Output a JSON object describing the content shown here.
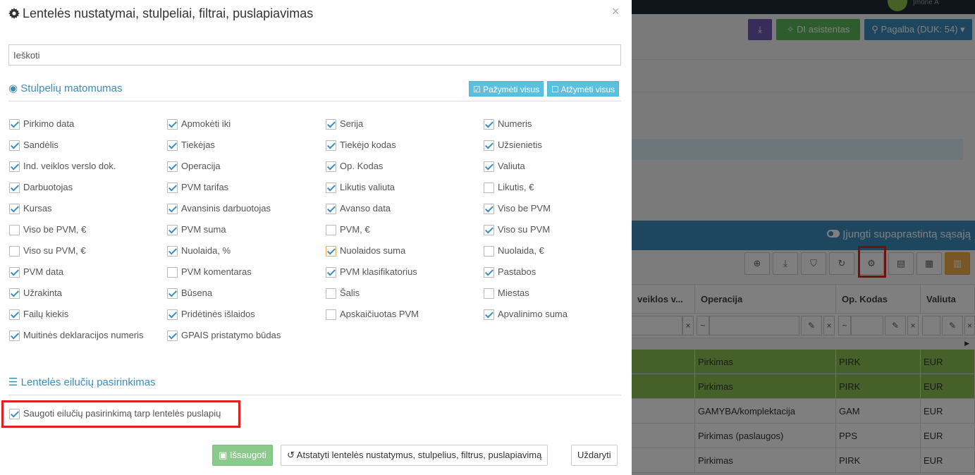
{
  "background": {
    "company": "Įmonė A",
    "header_buttons": {
      "ai": "DI asistentas",
      "help": "Pagalba (DUK: 54)"
    },
    "simplify_toggle": "Įjungti supaprastintą sąsają",
    "grid_headers": [
      " veiklos v...",
      "Operacija",
      "Op. Kodas",
      "Valiuta"
    ],
    "filter_op": "~",
    "filter_clear": "×",
    "rows": [
      {
        "operacija": "Pirkimas",
        "kodas": "PIRK",
        "valiuta": "EUR",
        "highlight": "#8cc152"
      },
      {
        "operacija": "Pirkimas",
        "kodas": "PIRK",
        "valiuta": "EUR",
        "highlight": "#8cc152"
      },
      {
        "operacija": "GAMYBA/komplektacija",
        "kodas": "GAM",
        "valiuta": "EUR",
        "highlight": ""
      },
      {
        "operacija": "Pirkimas (paslaugos)",
        "kodas": "PPS",
        "valiuta": "EUR",
        "highlight": ""
      },
      {
        "operacija": "Pirkimas",
        "kodas": "PIRK",
        "valiuta": "EUR",
        "highlight": ""
      }
    ]
  },
  "modal": {
    "title": "Lentelės nustatymai, stulpeliai, filtrai, puslapiavimas",
    "close": "×",
    "search_placeholder": "Ieškoti",
    "visibility_section": "Stulpelių matomumas",
    "select_all": "Pažymėti visus",
    "deselect_all": "Atžymėti visus",
    "columns": [
      [
        {
          "label": "Pirkimo data",
          "checked": true
        },
        {
          "label": "Sandėlis",
          "checked": true
        },
        {
          "label": "Ind. veiklos verslo dok.",
          "checked": true
        },
        {
          "label": "Darbuotojas",
          "checked": true
        },
        {
          "label": "Kursas",
          "checked": true
        },
        {
          "label": "Viso be PVM, €",
          "checked": false
        },
        {
          "label": "Viso su PVM, €",
          "checked": false
        },
        {
          "label": "PVM data",
          "checked": true
        },
        {
          "label": "Užrakinta",
          "checked": true
        },
        {
          "label": "Failų kiekis",
          "checked": true
        },
        {
          "label": "Muitinės deklaracijos numeris",
          "checked": true
        }
      ],
      [
        {
          "label": "Apmokėti iki",
          "checked": true
        },
        {
          "label": "Tiekėjas",
          "checked": true
        },
        {
          "label": "Operacija",
          "checked": true
        },
        {
          "label": "PVM tarifas",
          "checked": true
        },
        {
          "label": "Avansinis darbuotojas",
          "checked": true
        },
        {
          "label": "PVM suma",
          "checked": true
        },
        {
          "label": "Nuolaida, %",
          "checked": true
        },
        {
          "label": "PVM komentaras",
          "checked": false
        },
        {
          "label": "Būsena",
          "checked": true
        },
        {
          "label": "Pridėtinės išlaidos",
          "checked": true
        },
        {
          "label": "GPAIS pristatymo būdas",
          "checked": true
        }
      ],
      [
        {
          "label": "Serija",
          "checked": true
        },
        {
          "label": "Tiekėjo kodas",
          "checked": true
        },
        {
          "label": "Op. Kodas",
          "checked": true
        },
        {
          "label": "Likutis valiuta",
          "checked": true
        },
        {
          "label": "Avanso data",
          "checked": true
        },
        {
          "label": "PVM, €",
          "checked": false
        },
        {
          "label": "Nuolaidos suma",
          "checked": true,
          "focused": true
        },
        {
          "label": "PVM klasifikatorius",
          "checked": true
        },
        {
          "label": "Šalis",
          "checked": false
        },
        {
          "label": "Apskaičiuotas PVM",
          "checked": false
        }
      ],
      [
        {
          "label": "Numeris",
          "checked": true
        },
        {
          "label": "Užsienietis",
          "checked": true
        },
        {
          "label": "Valiuta",
          "checked": true
        },
        {
          "label": "Likutis, €",
          "checked": false
        },
        {
          "label": "Viso be PVM",
          "checked": true
        },
        {
          "label": "Viso su PVM",
          "checked": true
        },
        {
          "label": "Nuolaida, €",
          "checked": false
        },
        {
          "label": "Pastabos",
          "checked": true
        },
        {
          "label": "Miestas",
          "checked": false
        },
        {
          "label": "Apvalinimo suma",
          "checked": true
        }
      ]
    ],
    "rows_section": "Lentelės eilučių pasirinkimas",
    "save_selection": {
      "label": "Saugoti eilučių pasirinkimą tarp lentelės puslapių",
      "checked": true
    },
    "buttons": {
      "save": "Išsaugoti",
      "reset": "Atstatyti lentelės nustatymus, stulpelius, filtrus, puslapiavimą",
      "close": "Uždaryti"
    }
  },
  "colors": {
    "accent": "#3c8dbc",
    "save_button": "#8cc98c",
    "highlight_box": "#e02020"
  }
}
